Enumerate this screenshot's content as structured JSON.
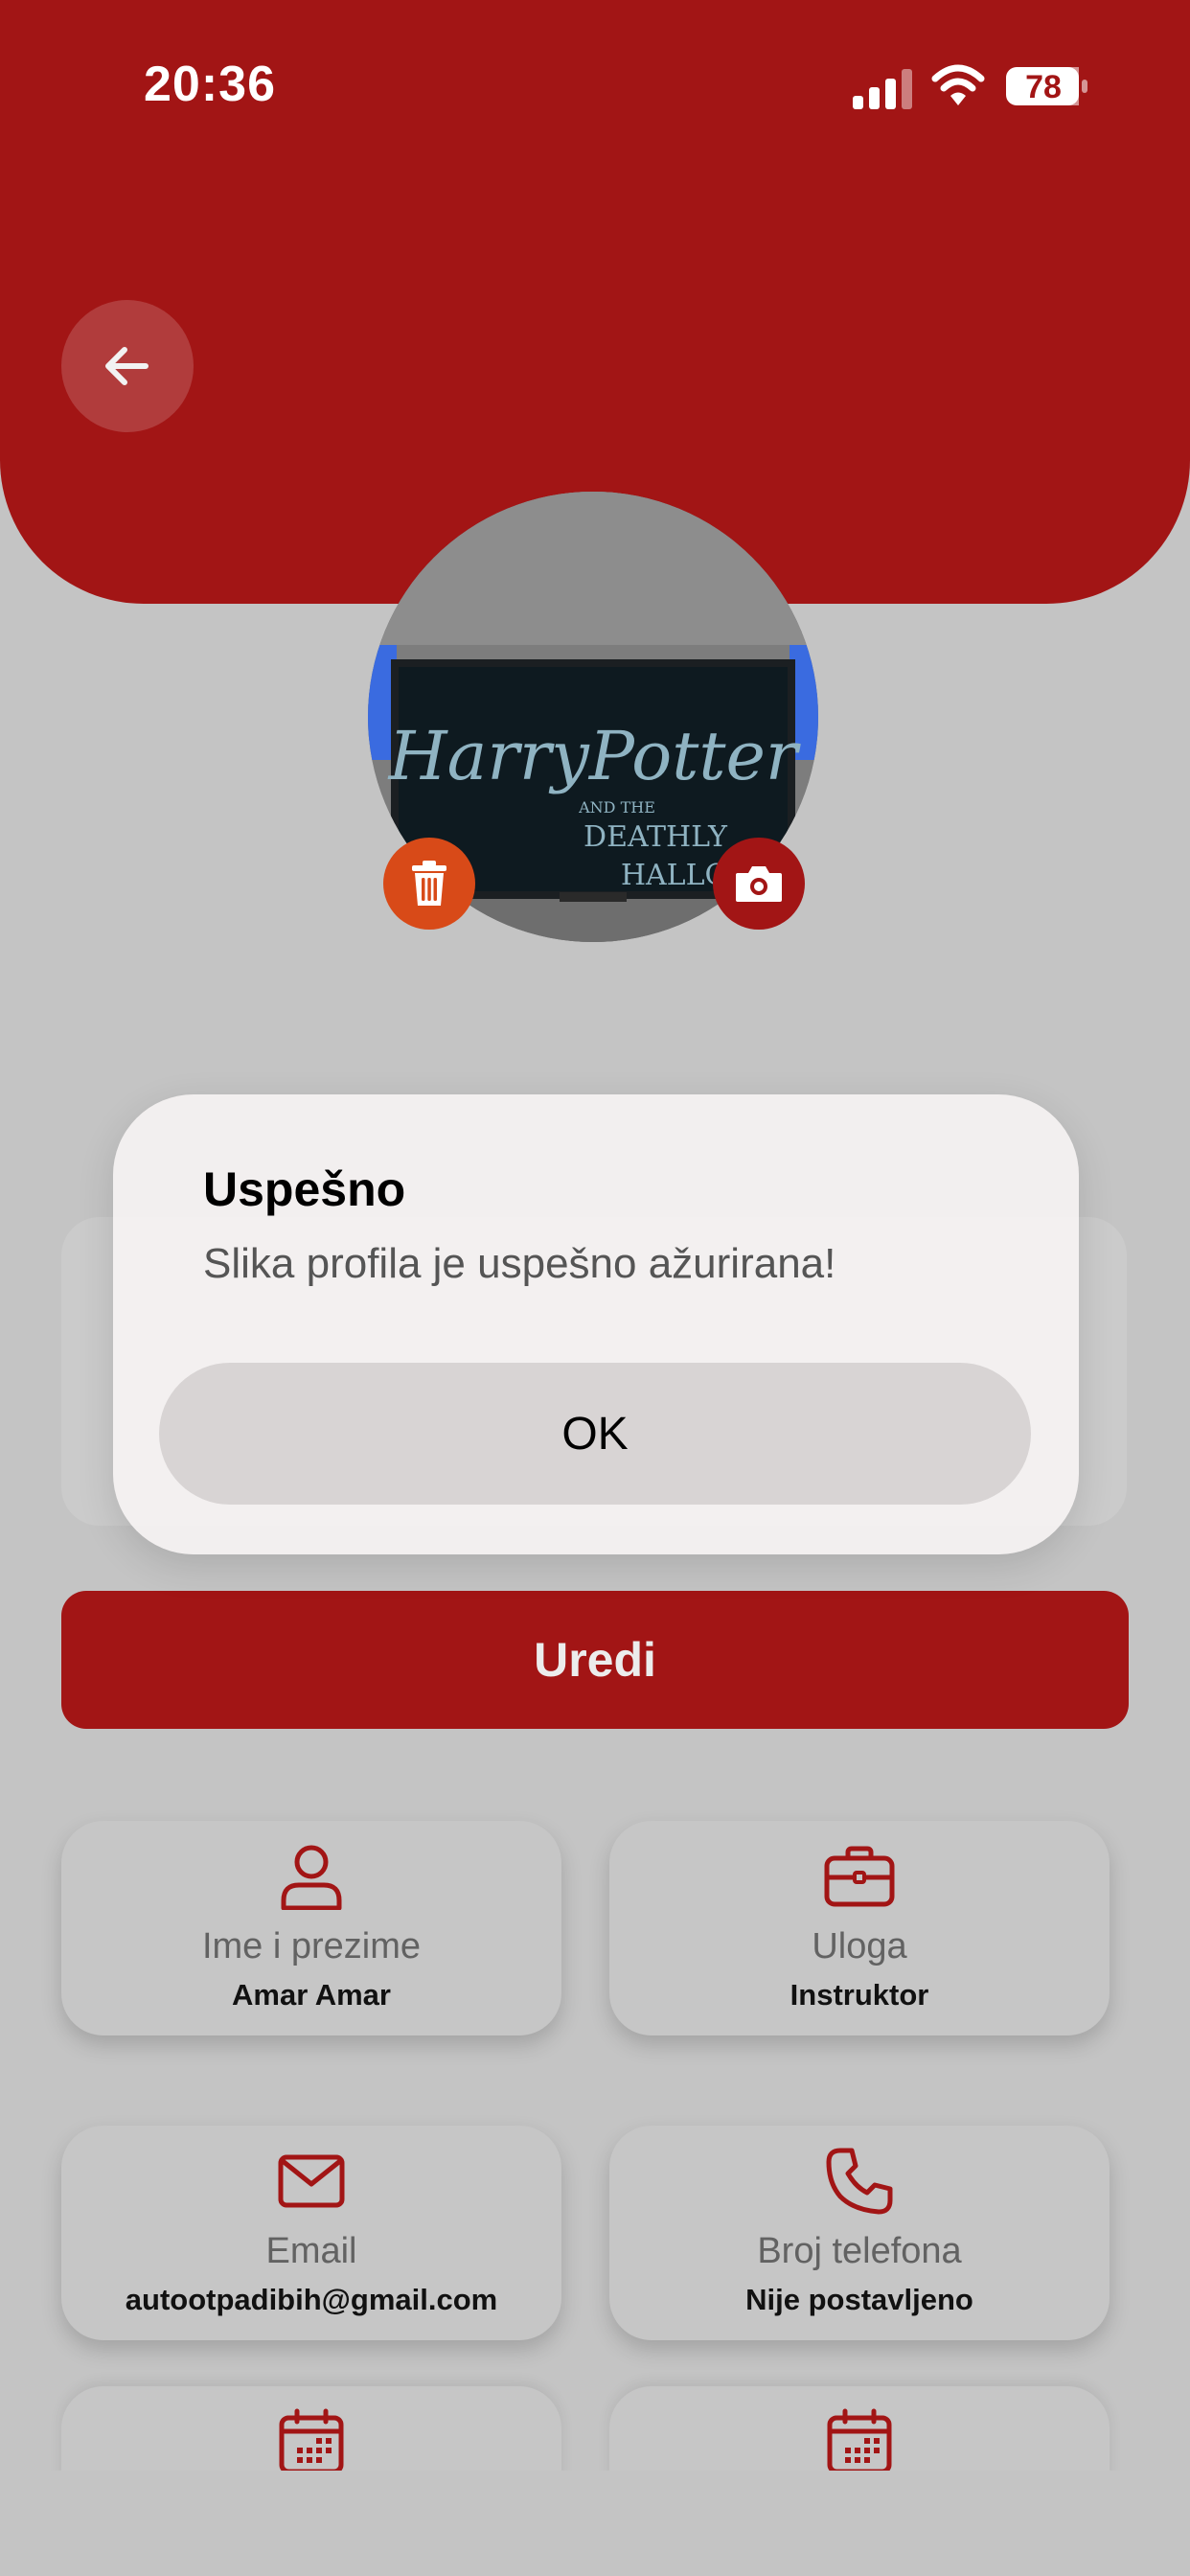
{
  "status_bar": {
    "time": "20:36",
    "battery": "78"
  },
  "colors": {
    "accent": "#a21515",
    "delete": "#d84a18",
    "background": "#c4c4c4"
  },
  "profile": {
    "photo_text": "HarryPotter",
    "photo_subtext_1": "AND THE",
    "photo_subtext_2": "DEATHLY",
    "photo_subtext_3": "HALLO"
  },
  "actions": {
    "edit_label": "Uredi"
  },
  "info_cards": [
    {
      "icon": "user-icon",
      "label": "Ime i prezime",
      "value": "Amar Amar"
    },
    {
      "icon": "briefcase-icon",
      "label": "Uloga",
      "value": "Instruktor"
    },
    {
      "icon": "mail-icon",
      "label": "Email",
      "value": "autootpadibih@gmail.com"
    },
    {
      "icon": "phone-icon",
      "label": "Broj telefona",
      "value": "Nije postavljeno"
    },
    {
      "icon": "calendar-icon"
    },
    {
      "icon": "calendar-icon"
    }
  ],
  "alert": {
    "title": "Uspešno",
    "message": "Slika profila je uspešno ažurirana!",
    "ok_label": "OK"
  }
}
